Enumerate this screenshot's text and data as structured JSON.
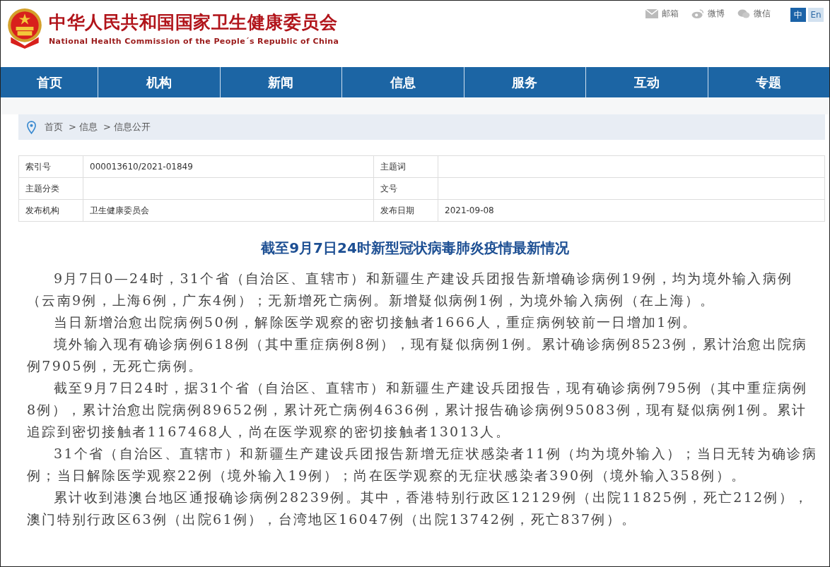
{
  "header": {
    "title": "中华人民共和国国家卫生健康委员会",
    "subtitle": "National Health Commission of the People´s Republic of China",
    "links": [
      {
        "kind": "mail",
        "label": "邮箱"
      },
      {
        "kind": "weibo",
        "label": "微博"
      },
      {
        "kind": "wechat",
        "label": "微信"
      }
    ],
    "languages": [
      {
        "label": "中",
        "selected": true
      },
      {
        "label": "En",
        "selected": false
      }
    ]
  },
  "nav": [
    "首页",
    "机构",
    "新闻",
    "信息",
    "服务",
    "互动",
    "专题"
  ],
  "breadcrumb": [
    "首页",
    "> 信息",
    "> 信息公开"
  ],
  "info_table": [
    [
      {
        "label": "索引号",
        "value": "000013610/2021-01849"
      },
      {
        "label": "主题词"
      }
    ],
    [
      {
        "label": "主题分类"
      },
      {
        "label": "文号"
      }
    ],
    [
      {
        "label": "发布机构",
        "value": "卫生健康委员会"
      },
      {
        "label": "发布日期",
        "value": "2021-09-08"
      }
    ]
  ],
  "article": {
    "title": "截至9月7日24时新型冠状病毒肺炎疫情最新情况",
    "paragraphs": [
      "9月7日0—24时，31个省（自治区、直辖市）和新疆生产建设兵团报告新增确诊病例19例，均为境外输入病例（云南9例，上海6例，广东4例）；无新增死亡病例。新增疑似病例1例，为境外输入病例（在上海）。",
      "当日新增治愈出院病例50例，解除医学观察的密切接触者1666人，重症病例较前一日增加1例。",
      "境外输入现有确诊病例618例（其中重症病例8例），现有疑似病例1例。累计确诊病例8523例，累计治愈出院病例7905例，无死亡病例。",
      "截至9月7日24时，据31个省（自治区、直辖市）和新疆生产建设兵团报告，现有确诊病例795例（其中重症病例8例），累计治愈出院病例89652例，累计死亡病例4636例，累计报告确诊病例95083例，现有疑似病例1例。累计追踪到密切接触者1167468人，尚在医学观察的密切接触者13013人。",
      "31个省（自治区、直辖市）和新疆生产建设兵团报告新增无症状感染者11例（均为境外输入）；当日无转为确诊病例；当日解除医学观察22例（境外输入19例）；尚在医学观察的无症状感染者390例（境外输入358例）。",
      "累计收到港澳台地区通报确诊病例28239例。其中，香港特别行政区12129例（出院11825例，死亡212例），澳门特别行政区63例（出院61例），台湾地区16047例（出院13742例，死亡837例）。"
    ]
  }
}
